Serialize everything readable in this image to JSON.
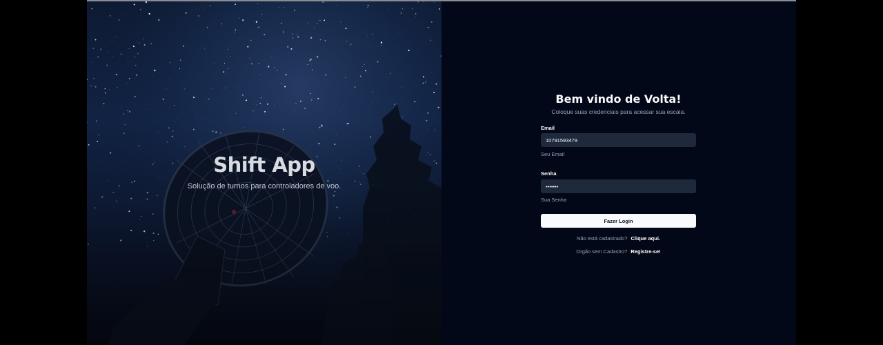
{
  "hero": {
    "title": "Shift App",
    "subtitle": "Solução de turnos para controladores de voo."
  },
  "login": {
    "title": "Bem vindo de Volta!",
    "subtitle": "Coloque suas credenciais para acessar sua escala.",
    "email": {
      "label": "Email",
      "value": "10791593479",
      "help": "Seu Email"
    },
    "password": {
      "label": "Senha",
      "value": "1234567",
      "help": "Sua Senha"
    },
    "submit_label": "Fazer Login",
    "register_prompt": "Não está cadastrado?",
    "register_link": "Clique aqui.",
    "org_prompt": "Orgão sem Cadastro?",
    "org_link": "Registre-se!"
  },
  "colors": {
    "panel_bg": "#020817",
    "input_bg": "#1e293b",
    "button_bg": "#f8fafc",
    "hero_sky": "#13264a"
  },
  "icons": {
    "hero_image": "radio-telescope-night-sky"
  }
}
